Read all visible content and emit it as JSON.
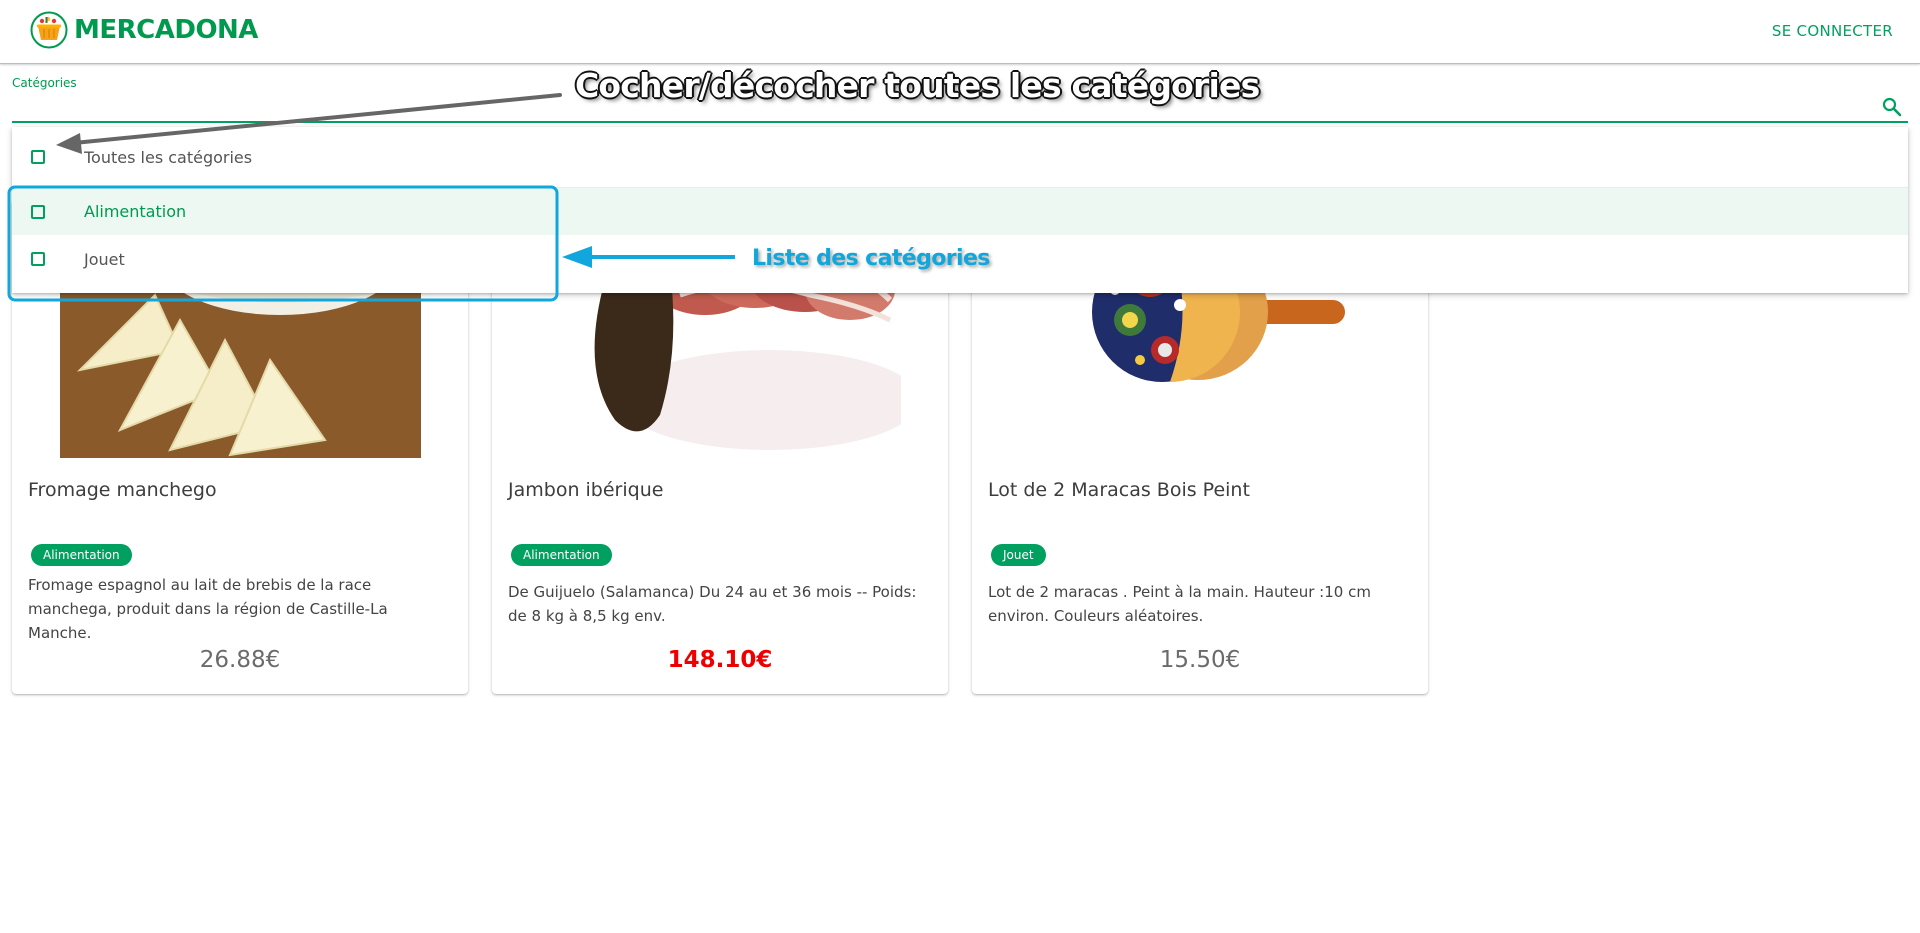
{
  "header": {
    "brand": "MERCADONA",
    "login_label": "SE CONNECTER"
  },
  "filter": {
    "label": "Catégories",
    "options": [
      {
        "label": "Toutes les catégories",
        "checked": false
      },
      {
        "label": "Alimentation",
        "checked": false,
        "highlighted": true
      },
      {
        "label": "Jouet",
        "checked": false
      }
    ]
  },
  "products": [
    {
      "title": "Fromage manchego",
      "category": "Alimentation",
      "description": "Fromage espagnol au lait de brebis de la race manchega, produit dans la région de Castille-La Manche.",
      "price": "26.88€",
      "promo": false
    },
    {
      "title": "Jambon ibérique",
      "category": "Alimentation",
      "description": "De Guijuelo (Salamanca) Du 24 au et 36 mois -- Poids: de 8 kg à 8,5 kg env.",
      "price": "148.10€",
      "promo": true
    },
    {
      "title": "Lot de 2 Maracas Bois Peint",
      "category": "Jouet",
      "description": "Lot de 2 maracas . Peint à la main. Hauteur :10 cm environ. Couleurs aléatoires.",
      "price": "15.50€",
      "promo": false
    }
  ],
  "annotations": {
    "select_all_note": "Cocher/décocher toutes les catégories",
    "list_note": "Liste des catégories"
  },
  "colors": {
    "brand_green": "#00a160",
    "promo_red": "#ef0000",
    "annotation_blue": "#11a7dc",
    "highlight_row": "#eef8f3"
  },
  "icons": {
    "logo": "shopping-basket-icon",
    "search": "search-icon",
    "checkbox": "checkbox-empty-icon"
  }
}
